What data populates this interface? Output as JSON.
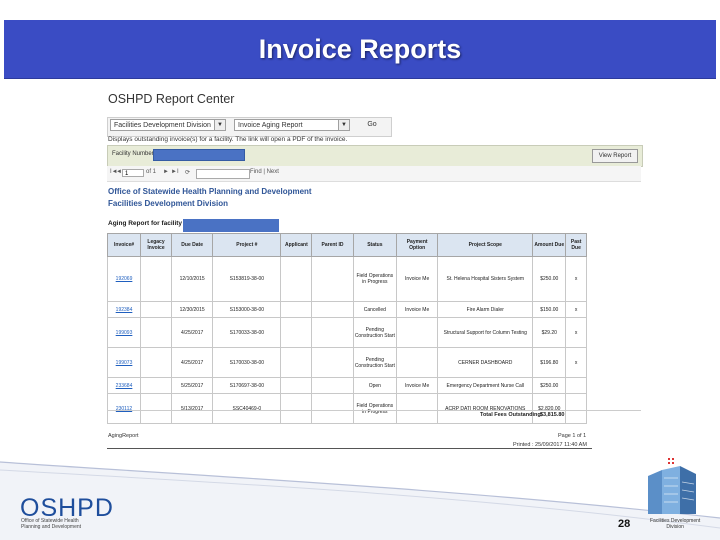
{
  "slide": {
    "title": "Invoice Reports",
    "page_number": "28"
  },
  "app": {
    "title": "OSHPD Report Center",
    "division_select": "Facilities Development Division",
    "report_select": "Invoice Aging Report",
    "go_label": "Go",
    "description": "Displays outstanding invoice(s) for a facility. The link will open a PDF of the invoice."
  },
  "params": {
    "facility_label": "Facility Number",
    "view_report_label": "View Report"
  },
  "navbar": {
    "first": "I◄",
    "prev": "◄",
    "page_value": "1",
    "of_label": "of 1",
    "next": "►",
    "last": "►I",
    "refresh": "⟳",
    "find_next": "Find | Next"
  },
  "report": {
    "org_name": "Office of Statewide Health Planning and Development",
    "division_name": "Facilities Development Division",
    "aging_title": "Aging Report for facility",
    "columns": [
      "Invoice#",
      "Legacy Invoice",
      "Due Date",
      "Project #",
      "Applicant",
      "Parent ID",
      "Status",
      "Payment Option",
      "Project Scope",
      "Amount Due",
      "Past Due"
    ],
    "rows": [
      {
        "invoice": "192069",
        "legacy": "",
        "due": "12/10/2015",
        "project": "S153819-38-00",
        "applicant": "",
        "parent": "",
        "status": "Field Operations in Progress",
        "payment": "Invoice Me",
        "scope": "St. Helena Hospital Sisters System",
        "amount": "$250.00",
        "past": "x"
      },
      {
        "invoice": "192384",
        "legacy": "",
        "due": "12/30/2015",
        "project": "S153000-38-00",
        "applicant": "",
        "parent": "",
        "status": "Cancelled",
        "payment": "Invoice Me",
        "scope": "Fire Alarm Dialer",
        "amount": "$150.00",
        "past": "x"
      },
      {
        "invoice": "199093",
        "legacy": "",
        "due": "4/25/2017",
        "project": "S170033-38-00",
        "applicant": "",
        "parent": "",
        "status": "Pending Construction Start",
        "payment": "",
        "scope": "Structural Support for Column Testing",
        "amount": "$29.20",
        "past": "x"
      },
      {
        "invoice": "199073",
        "legacy": "",
        "due": "4/25/2017",
        "project": "S170030-38-00",
        "applicant": "",
        "parent": "",
        "status": "Pending Construction Start",
        "payment": "",
        "scope": "CERNER DASHBOARD",
        "amount": "$196.80",
        "past": "x"
      },
      {
        "invoice": "233684",
        "legacy": "",
        "due": "5/25/2017",
        "project": "S170697-38-00",
        "applicant": "",
        "parent": "",
        "status": "Open",
        "payment": "Invoice Me",
        "scope": "Emergency Department Nurse Call",
        "amount": "$250.00",
        "past": ""
      },
      {
        "invoice": "230112",
        "legacy": "",
        "due": "5/13/2017",
        "project": "SSC40469-0",
        "applicant": "",
        "parent": "",
        "status": "Field Operations in Progress",
        "payment": "",
        "scope": "ACRP DATI ROOM RENOVATIONS",
        "amount": "$2,820.00",
        "past": ""
      }
    ],
    "total_label": "Total Fees Outstanding:",
    "total_value": "$3,815.80"
  },
  "footer": {
    "report_name": "AgingReport",
    "page_info": "Page 1 of 1",
    "printed": "Printed : 25/09/2017  11:40 AM"
  },
  "branding": {
    "oshpd_logo": "OSHPD",
    "oshpd_sub": "Office of Statewide Health\nPlanning and Development",
    "fdd_label": "Facilities Development\nDivision"
  },
  "colors": {
    "header_band": "#3a4cc4",
    "highlight_blue": "#4a72c4",
    "link_blue": "#1f5fbf",
    "org_text": "#2f5597"
  }
}
